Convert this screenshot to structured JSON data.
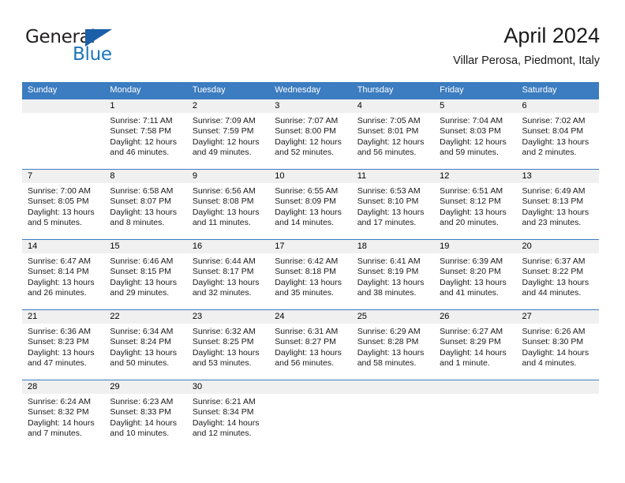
{
  "logo": {
    "word_one": "General",
    "word_two": "Blue",
    "flag_icon": "triangle-flag-icon",
    "accent_dark": "#231f20",
    "accent_blue": "#1b75bb"
  },
  "header": {
    "title": "April 2024",
    "subtitle": "Villar Perosa, Piedmont, Italy"
  },
  "theme": {
    "header_bar": "#3c7cc0",
    "day_number_band": "#f0f0f0",
    "text": "#1a1a1a"
  },
  "weekdays": [
    "Sunday",
    "Monday",
    "Tuesday",
    "Wednesday",
    "Thursday",
    "Friday",
    "Saturday"
  ],
  "weeks": [
    [
      {
        "day": "",
        "sunrise": "",
        "sunset": "",
        "daylight_line1": "",
        "daylight_line2": ""
      },
      {
        "day": "1",
        "sunrise": "Sunrise: 7:11 AM",
        "sunset": "Sunset: 7:58 PM",
        "daylight_line1": "Daylight: 12 hours",
        "daylight_line2": "and 46 minutes."
      },
      {
        "day": "2",
        "sunrise": "Sunrise: 7:09 AM",
        "sunset": "Sunset: 7:59 PM",
        "daylight_line1": "Daylight: 12 hours",
        "daylight_line2": "and 49 minutes."
      },
      {
        "day": "3",
        "sunrise": "Sunrise: 7:07 AM",
        "sunset": "Sunset: 8:00 PM",
        "daylight_line1": "Daylight: 12 hours",
        "daylight_line2": "and 52 minutes."
      },
      {
        "day": "4",
        "sunrise": "Sunrise: 7:05 AM",
        "sunset": "Sunset: 8:01 PM",
        "daylight_line1": "Daylight: 12 hours",
        "daylight_line2": "and 56 minutes."
      },
      {
        "day": "5",
        "sunrise": "Sunrise: 7:04 AM",
        "sunset": "Sunset: 8:03 PM",
        "daylight_line1": "Daylight: 12 hours",
        "daylight_line2": "and 59 minutes."
      },
      {
        "day": "6",
        "sunrise": "Sunrise: 7:02 AM",
        "sunset": "Sunset: 8:04 PM",
        "daylight_line1": "Daylight: 13 hours",
        "daylight_line2": "and 2 minutes."
      }
    ],
    [
      {
        "day": "7",
        "sunrise": "Sunrise: 7:00 AM",
        "sunset": "Sunset: 8:05 PM",
        "daylight_line1": "Daylight: 13 hours",
        "daylight_line2": "and 5 minutes."
      },
      {
        "day": "8",
        "sunrise": "Sunrise: 6:58 AM",
        "sunset": "Sunset: 8:07 PM",
        "daylight_line1": "Daylight: 13 hours",
        "daylight_line2": "and 8 minutes."
      },
      {
        "day": "9",
        "sunrise": "Sunrise: 6:56 AM",
        "sunset": "Sunset: 8:08 PM",
        "daylight_line1": "Daylight: 13 hours",
        "daylight_line2": "and 11 minutes."
      },
      {
        "day": "10",
        "sunrise": "Sunrise: 6:55 AM",
        "sunset": "Sunset: 8:09 PM",
        "daylight_line1": "Daylight: 13 hours",
        "daylight_line2": "and 14 minutes."
      },
      {
        "day": "11",
        "sunrise": "Sunrise: 6:53 AM",
        "sunset": "Sunset: 8:10 PM",
        "daylight_line1": "Daylight: 13 hours",
        "daylight_line2": "and 17 minutes."
      },
      {
        "day": "12",
        "sunrise": "Sunrise: 6:51 AM",
        "sunset": "Sunset: 8:12 PM",
        "daylight_line1": "Daylight: 13 hours",
        "daylight_line2": "and 20 minutes."
      },
      {
        "day": "13",
        "sunrise": "Sunrise: 6:49 AM",
        "sunset": "Sunset: 8:13 PM",
        "daylight_line1": "Daylight: 13 hours",
        "daylight_line2": "and 23 minutes."
      }
    ],
    [
      {
        "day": "14",
        "sunrise": "Sunrise: 6:47 AM",
        "sunset": "Sunset: 8:14 PM",
        "daylight_line1": "Daylight: 13 hours",
        "daylight_line2": "and 26 minutes."
      },
      {
        "day": "15",
        "sunrise": "Sunrise: 6:46 AM",
        "sunset": "Sunset: 8:15 PM",
        "daylight_line1": "Daylight: 13 hours",
        "daylight_line2": "and 29 minutes."
      },
      {
        "day": "16",
        "sunrise": "Sunrise: 6:44 AM",
        "sunset": "Sunset: 8:17 PM",
        "daylight_line1": "Daylight: 13 hours",
        "daylight_line2": "and 32 minutes."
      },
      {
        "day": "17",
        "sunrise": "Sunrise: 6:42 AM",
        "sunset": "Sunset: 8:18 PM",
        "daylight_line1": "Daylight: 13 hours",
        "daylight_line2": "and 35 minutes."
      },
      {
        "day": "18",
        "sunrise": "Sunrise: 6:41 AM",
        "sunset": "Sunset: 8:19 PM",
        "daylight_line1": "Daylight: 13 hours",
        "daylight_line2": "and 38 minutes."
      },
      {
        "day": "19",
        "sunrise": "Sunrise: 6:39 AM",
        "sunset": "Sunset: 8:20 PM",
        "daylight_line1": "Daylight: 13 hours",
        "daylight_line2": "and 41 minutes."
      },
      {
        "day": "20",
        "sunrise": "Sunrise: 6:37 AM",
        "sunset": "Sunset: 8:22 PM",
        "daylight_line1": "Daylight: 13 hours",
        "daylight_line2": "and 44 minutes."
      }
    ],
    [
      {
        "day": "21",
        "sunrise": "Sunrise: 6:36 AM",
        "sunset": "Sunset: 8:23 PM",
        "daylight_line1": "Daylight: 13 hours",
        "daylight_line2": "and 47 minutes."
      },
      {
        "day": "22",
        "sunrise": "Sunrise: 6:34 AM",
        "sunset": "Sunset: 8:24 PM",
        "daylight_line1": "Daylight: 13 hours",
        "daylight_line2": "and 50 minutes."
      },
      {
        "day": "23",
        "sunrise": "Sunrise: 6:32 AM",
        "sunset": "Sunset: 8:25 PM",
        "daylight_line1": "Daylight: 13 hours",
        "daylight_line2": "and 53 minutes."
      },
      {
        "day": "24",
        "sunrise": "Sunrise: 6:31 AM",
        "sunset": "Sunset: 8:27 PM",
        "daylight_line1": "Daylight: 13 hours",
        "daylight_line2": "and 56 minutes."
      },
      {
        "day": "25",
        "sunrise": "Sunrise: 6:29 AM",
        "sunset": "Sunset: 8:28 PM",
        "daylight_line1": "Daylight: 13 hours",
        "daylight_line2": "and 58 minutes."
      },
      {
        "day": "26",
        "sunrise": "Sunrise: 6:27 AM",
        "sunset": "Sunset: 8:29 PM",
        "daylight_line1": "Daylight: 14 hours",
        "daylight_line2": "and 1 minute."
      },
      {
        "day": "27",
        "sunrise": "Sunrise: 6:26 AM",
        "sunset": "Sunset: 8:30 PM",
        "daylight_line1": "Daylight: 14 hours",
        "daylight_line2": "and 4 minutes."
      }
    ],
    [
      {
        "day": "28",
        "sunrise": "Sunrise: 6:24 AM",
        "sunset": "Sunset: 8:32 PM",
        "daylight_line1": "Daylight: 14 hours",
        "daylight_line2": "and 7 minutes."
      },
      {
        "day": "29",
        "sunrise": "Sunrise: 6:23 AM",
        "sunset": "Sunset: 8:33 PM",
        "daylight_line1": "Daylight: 14 hours",
        "daylight_line2": "and 10 minutes."
      },
      {
        "day": "30",
        "sunrise": "Sunrise: 6:21 AM",
        "sunset": "Sunset: 8:34 PM",
        "daylight_line1": "Daylight: 14 hours",
        "daylight_line2": "and 12 minutes."
      },
      {
        "day": "",
        "sunrise": "",
        "sunset": "",
        "daylight_line1": "",
        "daylight_line2": ""
      },
      {
        "day": "",
        "sunrise": "",
        "sunset": "",
        "daylight_line1": "",
        "daylight_line2": ""
      },
      {
        "day": "",
        "sunrise": "",
        "sunset": "",
        "daylight_line1": "",
        "daylight_line2": ""
      },
      {
        "day": "",
        "sunrise": "",
        "sunset": "",
        "daylight_line1": "",
        "daylight_line2": ""
      }
    ]
  ]
}
